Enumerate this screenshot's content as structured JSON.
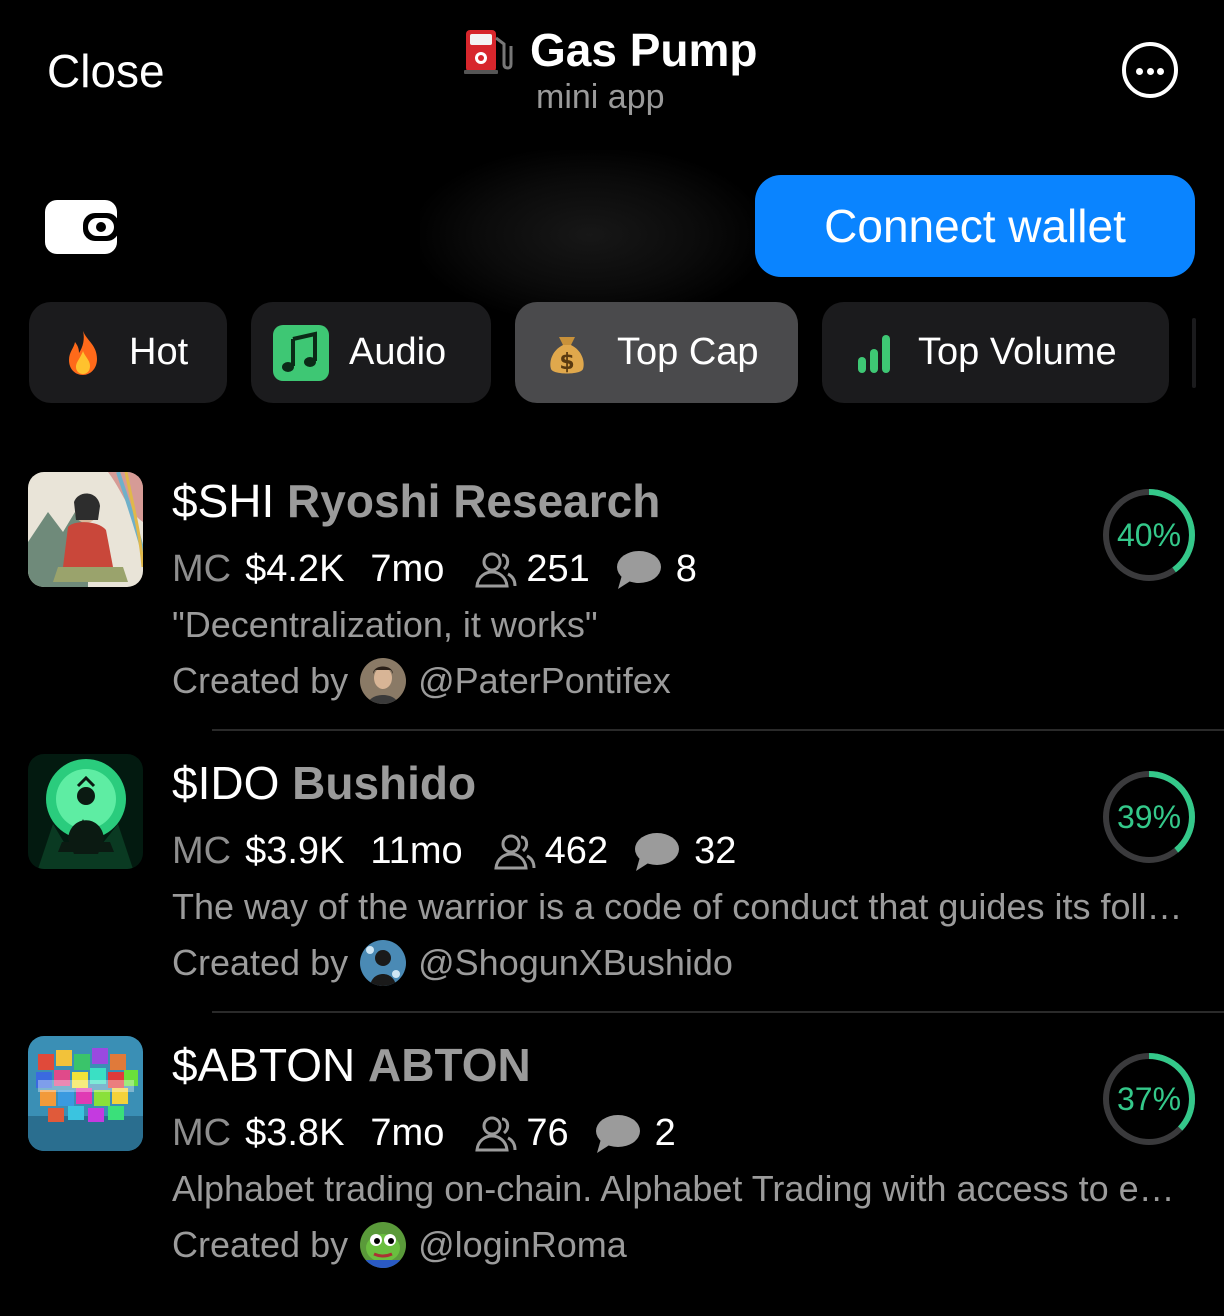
{
  "header": {
    "close_label": "Close",
    "title": "Gas Pump",
    "subtitle": "mini app",
    "more_icon": "more-icon"
  },
  "wallet": {
    "icon": "wallet-icon",
    "connect_label": "Connect wallet"
  },
  "tabs": [
    {
      "label": "Hot",
      "icon": "fire-icon",
      "active": false
    },
    {
      "label": "Audio",
      "icon": "music-note-icon",
      "active": false
    },
    {
      "label": "Top Cap",
      "icon": "money-bag-icon",
      "active": true
    },
    {
      "label": "Top Volume",
      "icon": "bar-chart-icon",
      "active": false
    }
  ],
  "tokens": [
    {
      "ticker": "$SHI",
      "name": "Ryoshi Research",
      "mc_label": "MC",
      "mc": "$4.2K",
      "age": "7mo",
      "holders": "251",
      "replies": "8",
      "description": "\"Decentralization, it works\"",
      "created_by_label": "Created by",
      "creator": "@PaterPontifex",
      "progress_label": "40%",
      "progress": 0.4
    },
    {
      "ticker": "$IDO",
      "name": "Bushido",
      "mc_label": "MC",
      "mc": "$3.9K",
      "age": "11mo",
      "holders": "462",
      "replies": "32",
      "description": "The way of the warrior is a code of conduct that guides its followers to be loyal, honorable and brave",
      "created_by_label": "Created by",
      "creator": "@ShogunXBushido",
      "progress_label": "39%",
      "progress": 0.39
    },
    {
      "ticker": "$ABTON",
      "name": "ABTON",
      "mc_label": "MC",
      "mc": "$3.8K",
      "age": "7mo",
      "holders": "76",
      "replies": "2",
      "description": "Alphabet trading on-chain. Alphabet Trading with access to everyone",
      "created_by_label": "Created by",
      "creator": "@loginRoma",
      "progress_label": "37%",
      "progress": 0.37
    }
  ],
  "colors": {
    "accent": "#0a84ff",
    "progress": "#34c88a",
    "track": "#3a3a3c",
    "muted": "#9b9b9b"
  }
}
